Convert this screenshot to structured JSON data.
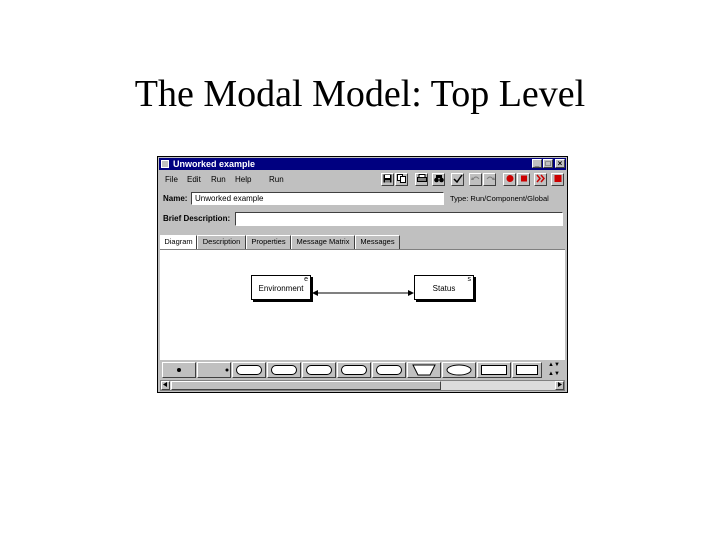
{
  "slide": {
    "title": "The Modal Model: Top Level"
  },
  "window": {
    "title": "Unworked example",
    "controls": {
      "minimize": "_",
      "maximize": "□",
      "close": "×"
    }
  },
  "menubar": {
    "items": [
      "File",
      "Edit",
      "Run",
      "Help",
      "Run"
    ]
  },
  "toolbar": {
    "icons": [
      "save-icon",
      "copy-icon",
      "print-icon",
      "binoculars-icon",
      "check-icon",
      "undo-icon",
      "redo-icon",
      "run-record-icon",
      "stop-icon",
      "fast-forward-icon",
      "halt-icon"
    ]
  },
  "form": {
    "name_label": "Name:",
    "name_value": "Unworked example",
    "type_label": "Type: Run/Component/Global",
    "brief_label": "Brief Description:",
    "brief_value": ""
  },
  "tabs": [
    "Diagram",
    "Description",
    "Properties",
    "Message Matrix",
    "Messages"
  ],
  "diagram": {
    "nodes": [
      {
        "label": "Environment",
        "corner": "e"
      },
      {
        "label": "Status",
        "corner": "s"
      }
    ]
  },
  "palette": {
    "side_top": "▲▼",
    "side_bottom": "▲▼"
  },
  "colors": {
    "titlebar": "#000080",
    "chrome": "#c0c0c0",
    "stop": "#cc0000"
  }
}
